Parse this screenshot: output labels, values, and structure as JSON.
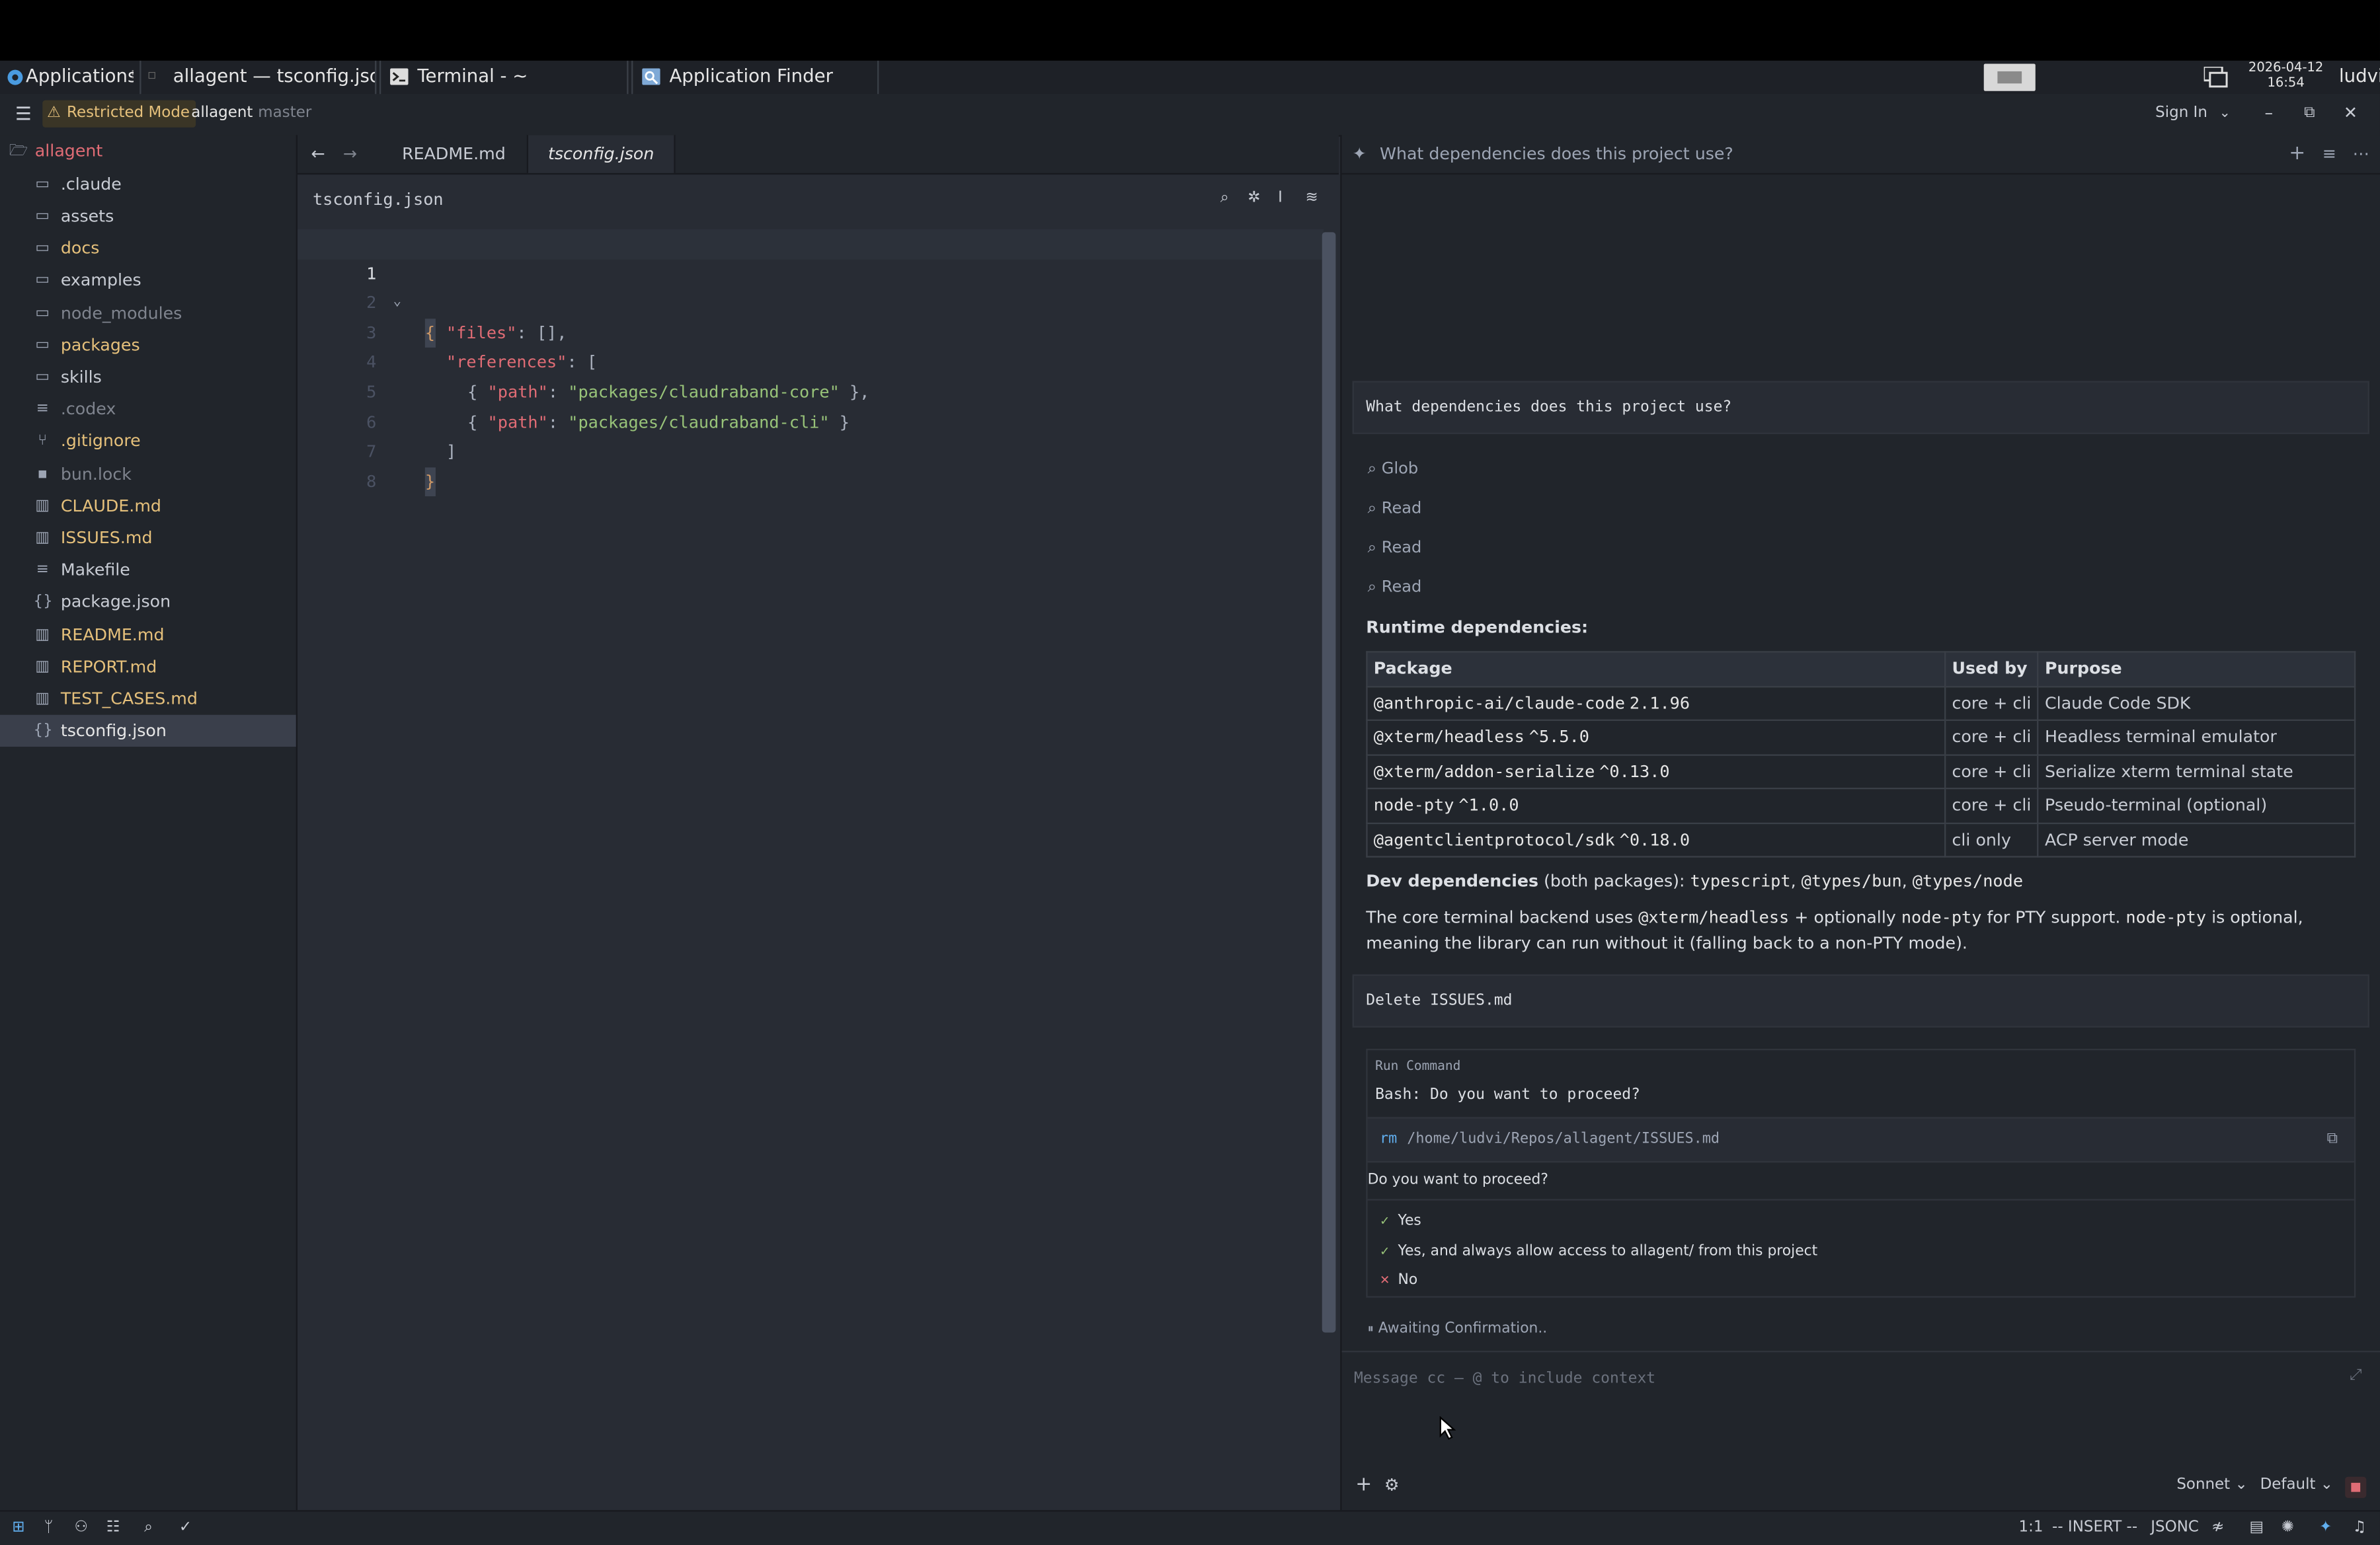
{
  "taskbar": {
    "applications": "Applications",
    "tasks": [
      "allagent — tsconfig.json",
      "Terminal - ~",
      "Application Finder"
    ],
    "date": "2026-04-12",
    "time": "16:54",
    "user": "ludvi"
  },
  "titlebar": {
    "restricted_mode": "Restricted Mode",
    "project": "allagent",
    "branch": "master",
    "sign_in": "Sign In"
  },
  "sidebar": {
    "root": "allagent",
    "items": [
      {
        "label": ".claude",
        "icon": "folder-icon",
        "color": "#c8ccd4"
      },
      {
        "label": "assets",
        "icon": "folder-icon",
        "color": "#c8ccd4"
      },
      {
        "label": "docs",
        "icon": "folder-icon",
        "color": "#e5c07b"
      },
      {
        "label": "examples",
        "icon": "folder-icon",
        "color": "#c8ccd4"
      },
      {
        "label": "node_modules",
        "icon": "folder-icon",
        "color": "#7f848e"
      },
      {
        "label": "packages",
        "icon": "folder-icon",
        "color": "#e5c07b"
      },
      {
        "label": "skills",
        "icon": "folder-icon",
        "color": "#c8ccd4"
      },
      {
        "label": ".codex",
        "icon": "lines-icon",
        "color": "#7f848e"
      },
      {
        "label": ".gitignore",
        "icon": "git-icon",
        "color": "#e5c07b"
      },
      {
        "label": "bun.lock",
        "icon": "lock-icon",
        "color": "#7f848e"
      },
      {
        "label": "CLAUDE.md",
        "icon": "book-icon",
        "color": "#e5c07b"
      },
      {
        "label": "ISSUES.md",
        "icon": "book-icon",
        "color": "#e5c07b"
      },
      {
        "label": "Makefile",
        "icon": "lines-icon",
        "color": "#c8ccd4"
      },
      {
        "label": "package.json",
        "icon": "braces-icon",
        "color": "#c8ccd4"
      },
      {
        "label": "README.md",
        "icon": "book-icon",
        "color": "#e5c07b"
      },
      {
        "label": "REPORT.md",
        "icon": "book-icon",
        "color": "#e5c07b"
      },
      {
        "label": "TEST_CASES.md",
        "icon": "book-icon",
        "color": "#e5c07b"
      },
      {
        "label": "tsconfig.json",
        "icon": "braces-icon",
        "color": "#e6e6e6"
      }
    ]
  },
  "editor": {
    "tabs": [
      "README.md",
      "tsconfig.json"
    ],
    "active_tab": "tsconfig.json",
    "breadcrumb": "tsconfig.json",
    "line_numbers": [
      "1",
      "2",
      "3",
      "4",
      "5",
      "6",
      "7",
      "8"
    ],
    "code": {
      "l1": "{",
      "l2_key": "\"files\"",
      "l2_rest": ": [],",
      "l3_key": "\"references\"",
      "l3_rest": ": [",
      "l4_open": "{ ",
      "l4_key": "\"path\"",
      "l4_colon": ": ",
      "l4_val": "\"packages/claudraband-core\"",
      "l4_close": " },",
      "l5_open": "{ ",
      "l5_key": "\"path\"",
      "l5_colon": ": ",
      "l5_val": "\"packages/claudraband-cli\"",
      "l5_close": " }",
      "l6": "]",
      "l7": "}"
    }
  },
  "chat": {
    "header_title": "What dependencies does this project use?",
    "user_message": "What dependencies does this project use?",
    "tools": [
      "Glob",
      "Read",
      "Read",
      "Read"
    ],
    "runtime_heading": "Runtime dependencies:",
    "table": {
      "headers": [
        "Package",
        "Used by",
        "Purpose"
      ],
      "rows": [
        {
          "pkg": "@anthropic-ai/claude-code",
          "ver": "2.1.96",
          "used": "core + cli",
          "purpose": "Claude Code SDK"
        },
        {
          "pkg": "@xterm/headless",
          "ver": "^5.5.0",
          "used": "core + cli",
          "purpose": "Headless terminal emulator"
        },
        {
          "pkg": "@xterm/addon-serialize",
          "ver": "^0.13.0",
          "used": "core + cli",
          "purpose": "Serialize xterm terminal state"
        },
        {
          "pkg": "node-pty",
          "ver": "^1.0.0",
          "used": "core + cli",
          "purpose": "Pseudo-terminal (optional)"
        },
        {
          "pkg": "@agentclientprotocol/sdk",
          "ver": "^0.18.0",
          "used": "cli only",
          "purpose": "ACP server mode"
        }
      ]
    },
    "dev": {
      "label": "Dev dependencies",
      "paren": "(both packages):",
      "pkgs": [
        "typescript",
        "@types/bun",
        "@types/node"
      ]
    },
    "summary": {
      "t1": "The core terminal backend uses ",
      "c1": "@xterm/headless",
      "t2": " + optionally ",
      "c2": "node-pty",
      "t3": " for PTY support. ",
      "c3": "node-pty",
      "t4": " is optional, meaning the library can run without it (falling back to a non-PTY mode)."
    },
    "user_message2": "Delete ISSUES.md",
    "permission": {
      "label": "Run Command",
      "title": "Bash: Do you want to proceed?",
      "cmd_prefix": "rm",
      "cmd_path": "/home/ludvi/Repos/allagent/ISSUES.md",
      "question": "Do you want to proceed?",
      "options": [
        {
          "mark": "✓",
          "label": "Yes"
        },
        {
          "mark": "✓",
          "label": "Yes, and always allow access to allagent/ from this project"
        },
        {
          "mark": "✕",
          "label": "No"
        }
      ]
    },
    "awaiting": "Awaiting Confirmation..",
    "input_placeholder": "Message cc — @ to include context",
    "model": "Sonnet",
    "mode": "Default"
  },
  "statusbar": {
    "position": "1:1",
    "mode": "-- INSERT --",
    "language": "JSONC"
  }
}
